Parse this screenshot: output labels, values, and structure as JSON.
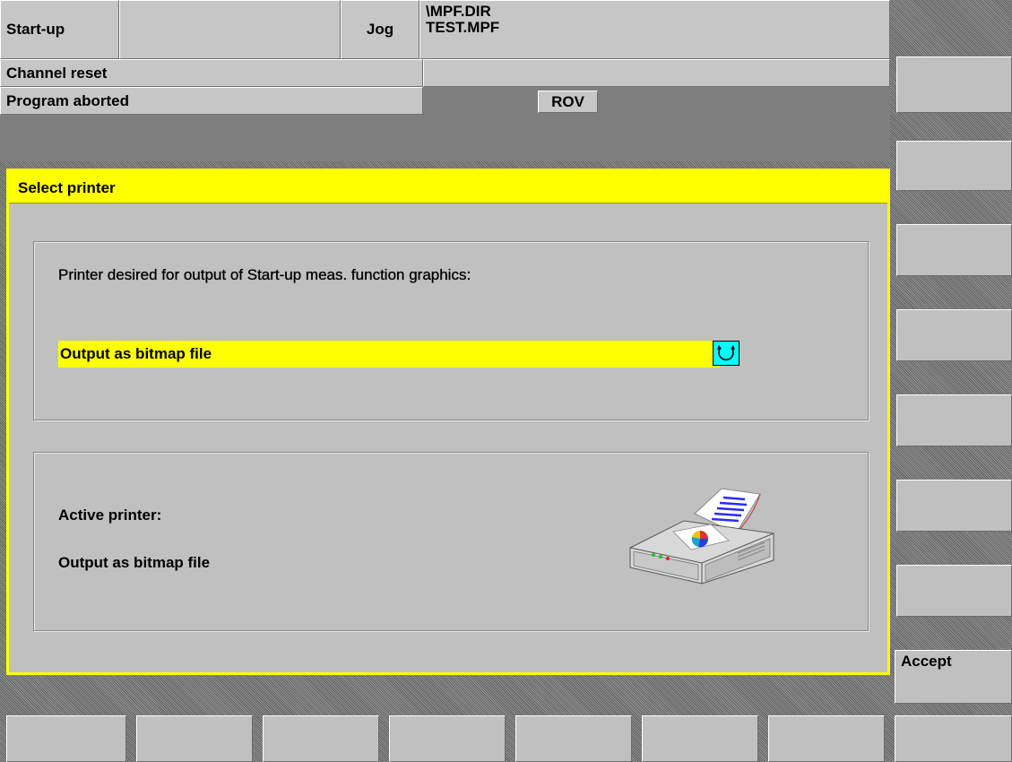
{
  "header": {
    "area": "Start-up",
    "empty_field": "",
    "mode": "Jog",
    "path_line1": "\\MPF.DIR",
    "path_line2": "TEST.MPF",
    "channel_state": "Channel reset",
    "program_state": "Program aborted",
    "rov_label": "ROV"
  },
  "dialog": {
    "title": "Select printer",
    "prompt": "Printer desired for output of Start-up meas. function graphics:",
    "selected_option": "Output as bitmap file",
    "toggle_icon": "cycle-toggle-icon",
    "active_label": "Active printer:",
    "active_value": "Output as bitmap file",
    "printer_icon": "printer-icon"
  },
  "vertical_softkeys": [
    "",
    "",
    "",
    "",
    "",
    "",
    "",
    "Accept"
  ],
  "horizontal_softkeys": [
    "",
    "",
    "",
    "",
    "",
    "",
    "",
    ""
  ],
  "colors": {
    "highlight": "#ffff00",
    "panel": "#c0c0c0",
    "toggle_bg": "#00ffff"
  }
}
